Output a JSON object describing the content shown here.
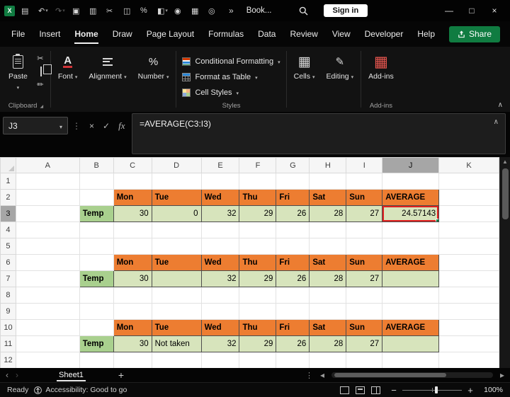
{
  "colors": {
    "excel_green": "#107C41",
    "header_orange": "#ED7D31",
    "label_green": "#A9D08E",
    "data_green": "#D7E4BC",
    "selection_red": "#E0201F"
  },
  "titlebar": {
    "title": "Book...",
    "sign_in_label": "Sign in",
    "more_commands_glyph": "»",
    "quick_access": [
      {
        "name": "excel-logo-icon",
        "glyph": "X"
      },
      {
        "name": "save-icon",
        "glyph": "▤"
      },
      {
        "name": "undo-icon",
        "glyph": "↶",
        "caret": true
      },
      {
        "name": "redo-icon",
        "glyph": "↷",
        "caret": true
      },
      {
        "name": "clipboard-icon",
        "glyph": "▣"
      },
      {
        "name": "copy-icon",
        "glyph": "▥"
      },
      {
        "name": "cut-icon",
        "glyph": "✂"
      },
      {
        "name": "book-icon",
        "glyph": "◫"
      },
      {
        "name": "number-format-icon",
        "glyph": "%"
      },
      {
        "name": "format-painter-icon",
        "glyph": "◧",
        "caret": true
      },
      {
        "name": "pin-icon",
        "glyph": "◉"
      },
      {
        "name": "table-icon",
        "glyph": "▦"
      },
      {
        "name": "camera-icon",
        "glyph": "◎"
      }
    ],
    "window": {
      "minimize": "—",
      "maximize": "□",
      "close": "×"
    }
  },
  "menubar": {
    "items": [
      "File",
      "Insert",
      "Home",
      "Draw",
      "Page Layout",
      "Formulas",
      "Data",
      "Review",
      "View",
      "Developer",
      "Help"
    ],
    "active_item": "Home",
    "share_label": "Share"
  },
  "ribbon": {
    "paste_label": "Paste",
    "buttons": {
      "font": "Font",
      "alignment": "Alignment",
      "number": "Number",
      "conditional_formatting": "Conditional Formatting",
      "format_as_table": "Format as Table",
      "cell_styles": "Cell Styles",
      "cells": "Cells",
      "editing": "Editing",
      "addins": "Add-ins"
    },
    "group_labels": {
      "clipboard": "Clipboard",
      "styles": "Styles",
      "addins": "Add-ins"
    }
  },
  "formula_bar": {
    "name_box": "J3",
    "cancel_glyph": "×",
    "enter_glyph": "✓",
    "fx_label": "fx",
    "formula": "=AVERAGE(C3:I3)"
  },
  "grid": {
    "columns": [
      "A",
      "B",
      "C",
      "D",
      "E",
      "F",
      "G",
      "H",
      "I",
      "J",
      "K"
    ],
    "rows": [
      "1",
      "2",
      "3",
      "4",
      "5",
      "6",
      "7",
      "8",
      "9",
      "10",
      "11",
      "12"
    ],
    "day_headers": [
      "Mon",
      "Tue",
      "Wed",
      "Thu",
      "Fri",
      "Sat",
      "Sun"
    ],
    "day_columns": [
      "C",
      "D",
      "E",
      "F",
      "G",
      "H",
      "I"
    ],
    "average_header": "AVERAGE",
    "row_label": "Temp",
    "selected": {
      "cell": "J3",
      "column": "J",
      "row": "3"
    },
    "blocks": [
      {
        "header_row": "2",
        "data_row": "3",
        "values": {
          "C": "30",
          "D": "0",
          "E": "32",
          "F": "29",
          "G": "26",
          "H": "28",
          "I": "27",
          "J": "24.57143"
        }
      },
      {
        "header_row": "6",
        "data_row": "7",
        "values": {
          "C": "30",
          "E": "32",
          "F": "29",
          "G": "26",
          "H": "28",
          "I": "27"
        }
      },
      {
        "header_row": "10",
        "data_row": "11",
        "values": {
          "C": "30",
          "D": "Not taken",
          "E": "32",
          "F": "29",
          "G": "26",
          "H": "28",
          "I": "27"
        }
      }
    ]
  },
  "sheetbar": {
    "active_tab": "Sheet1",
    "add_glyph": "+"
  },
  "statusbar": {
    "ready": "Ready",
    "accessibility": "Accessibility: Good to go",
    "zoom": "100%"
  }
}
